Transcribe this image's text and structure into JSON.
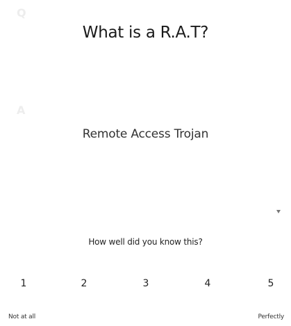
{
  "card": {
    "question_marker": "Q",
    "question": "What is a R.A.T?",
    "answer_marker": "A",
    "answer": "Remote Access Trojan"
  },
  "rating": {
    "prompt": "How well did you know this?",
    "options": [
      "1",
      "2",
      "3",
      "4",
      "5"
    ],
    "low_label": "Not at all",
    "high_label": "Perfectly"
  },
  "icons": {
    "menu": "chevron-down-icon"
  },
  "colors": {
    "marker": "#ededed",
    "text": "#222222"
  }
}
